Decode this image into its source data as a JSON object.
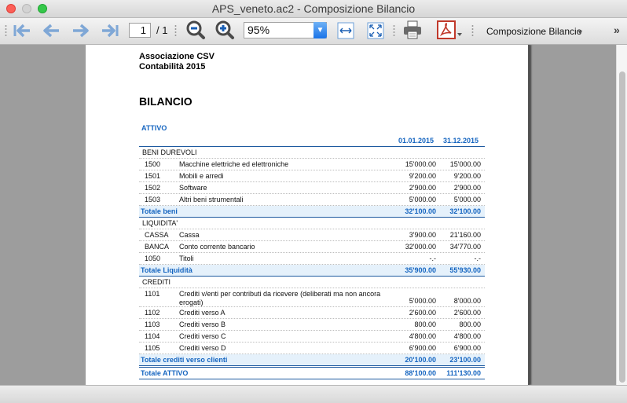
{
  "window": {
    "title": "APS_veneto.ac2 - Composizione Bilancio"
  },
  "toolbar": {
    "page_current": "1",
    "page_total": "/ 1",
    "zoom": "95%",
    "report_name": "Composizione Bilancio",
    "icons": [
      "first-page-icon",
      "previous-page-icon",
      "next-page-icon",
      "last-page-icon",
      "zoom-out-icon",
      "zoom-in-icon",
      "fit-width-icon",
      "fit-page-icon",
      "print-icon",
      "pdf-icon",
      "overflow-chevron-icon"
    ]
  },
  "report": {
    "org_line1": "Associazione CSV",
    "org_line2": "Contabilità 2015",
    "title": "BILANCIO",
    "section": "ATTIVO",
    "col1": "01.01.2015",
    "col2": "31.12.2015",
    "groups": [
      {
        "name": "BENI DUREVOLI",
        "rows": [
          {
            "code": "1500",
            "desc": "Macchine elettriche ed elettroniche",
            "v1": "15'000.00",
            "v2": "15'000.00"
          },
          {
            "code": "1501",
            "desc": "Mobili e arredi",
            "v1": "9'200.00",
            "v2": "9'200.00"
          },
          {
            "code": "1502",
            "desc": "Software",
            "v1": "2'900.00",
            "v2": "2'900.00"
          },
          {
            "code": "1503",
            "desc": "Altri beni strumentali",
            "v1": "5'000.00",
            "v2": "5'000.00"
          }
        ],
        "total": {
          "label": "Totale beni",
          "v1": "32'100.00",
          "v2": "32'100.00"
        }
      },
      {
        "name": "LIQUIDITA'",
        "rows": [
          {
            "code": "CASSA",
            "desc": "Cassa",
            "v1": "3'900.00",
            "v2": "21'160.00"
          },
          {
            "code": "BANCA",
            "desc": "Conto corrente bancario",
            "v1": "32'000.00",
            "v2": "34'770.00"
          },
          {
            "code": "1050",
            "desc": "Titoli",
            "v1": "-.-",
            "v2": "-.-"
          }
        ],
        "total": {
          "label": "Totale Liquidità",
          "v1": "35'900.00",
          "v2": "55'930.00"
        }
      },
      {
        "name": "CREDITI",
        "rows": [
          {
            "code": "1101",
            "desc": "Crediti v/enti per contributi da ricevere (deliberati ma non ancora erogati)",
            "v1": "5'000.00",
            "v2": "8'000.00"
          },
          {
            "code": "1102",
            "desc": "Crediti verso A",
            "v1": "2'600.00",
            "v2": "2'600.00"
          },
          {
            "code": "1103",
            "desc": "Crediti verso B",
            "v1": "800.00",
            "v2": "800.00"
          },
          {
            "code": "1104",
            "desc": "Crediti verso C",
            "v1": "4'800.00",
            "v2": "4'800.00"
          },
          {
            "code": "1105",
            "desc": "Crediti verso D",
            "v1": "6'900.00",
            "v2": "6'900.00"
          }
        ],
        "total": {
          "label": "Totale crediti verso clienti",
          "v1": "20'100.00",
          "v2": "23'100.00"
        }
      }
    ],
    "grand_total": {
      "label": "Totale ATTIVO",
      "v1": "88'100.00",
      "v2": "111'130.00"
    }
  },
  "colors": {
    "accent": "#1565c0",
    "total_bg": "#e5f1fb"
  }
}
